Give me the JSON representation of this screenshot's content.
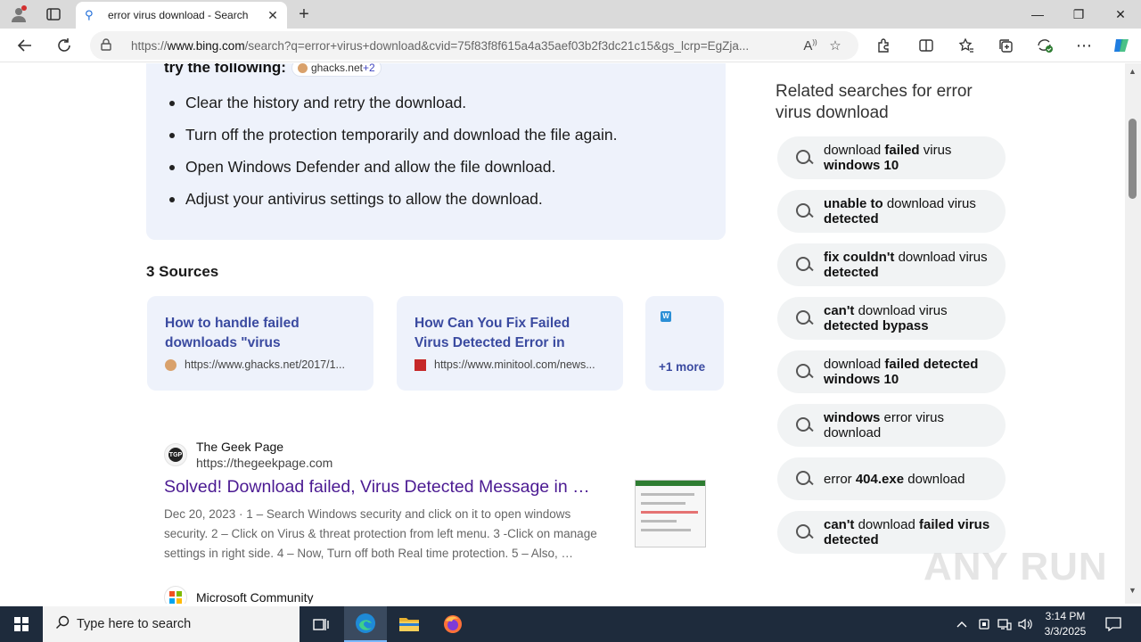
{
  "browser": {
    "tab_title": "error virus download - Search",
    "url_prefix": "https://",
    "url_host": "www.bing.com",
    "url_rest": "/search?q=error+virus+download&cvid=75f83f8f615a4a35aef03b2f3dc21c15&gs_lcrp=EgZja...",
    "tab_close": "✕",
    "new_tab": "+",
    "minimize": "—",
    "maximize": "❐",
    "close": "✕"
  },
  "answer": {
    "intro": "try the following:",
    "cite_site": "ghacks.net",
    "cite_more": "+2",
    "bullets": [
      "Clear the history and retry the download.",
      "Turn off the protection temporarily and download the file again.",
      "Open Windows Defender and allow the file download.",
      "Adjust your antivirus settings to allow the download."
    ]
  },
  "sources": {
    "heading": "3 Sources",
    "cards": [
      {
        "title": "How to handle failed downloads \"virus detected\"…",
        "url": "https://www.ghacks.net/2017/1..."
      },
      {
        "title": "How Can You Fix Failed Virus Detected Error in Google…",
        "url": "https://www.minitool.com/news..."
      }
    ],
    "more_label": "+1 more",
    "more_icon": "W"
  },
  "results": [
    {
      "site_name": "The Geek Page",
      "site_url": "https://thegeekpage.com",
      "fav_text": "TGP",
      "title": "Solved! Download failed, Virus Detected Message in …",
      "desc": "Dec 20, 2023 · 1 – Search Windows security and click on it to open windows security. 2 – Click on Virus & threat protection from left menu. 3 -Click on manage settings in right side. 4 – Now, Turn off both Real time protection. 5 – Also, …"
    },
    {
      "site_name": "Microsoft Community"
    }
  ],
  "related": {
    "heading": "Related searches for error virus download",
    "items": [
      {
        "normal": "download ",
        "bold": "failed",
        "normal2": " virus ",
        "bold2": "windows 10"
      },
      {
        "normal": "",
        "bold": "unable to",
        "normal2": " download virus ",
        "bold2": "detected"
      },
      {
        "normal": "",
        "bold": "fix couldn't",
        "normal2": " download virus ",
        "bold2": "detected"
      },
      {
        "normal": "",
        "bold": "can't",
        "normal2": " download virus ",
        "bold2": "detected bypass"
      },
      {
        "normal": "download ",
        "bold": "failed detected",
        "normal2": " ",
        "bold2": "windows 10"
      },
      {
        "normal": "",
        "bold": "windows",
        "normal2": " error virus download",
        "bold2": ""
      },
      {
        "normal": "error ",
        "bold": "404.exe",
        "normal2": " download",
        "bold2": ""
      },
      {
        "normal": "",
        "bold": "can't",
        "normal2": " download ",
        "bold2": "failed virus detected"
      }
    ]
  },
  "watermark": "ANY RUN",
  "taskbar": {
    "search_placeholder": "Type here to search",
    "time": "3:14 PM",
    "date": "3/3/2025"
  },
  "colors": {
    "accent_link": "#3a4aa0",
    "visited_link": "#4b1a92",
    "taskbar": "#1e2b3c"
  }
}
